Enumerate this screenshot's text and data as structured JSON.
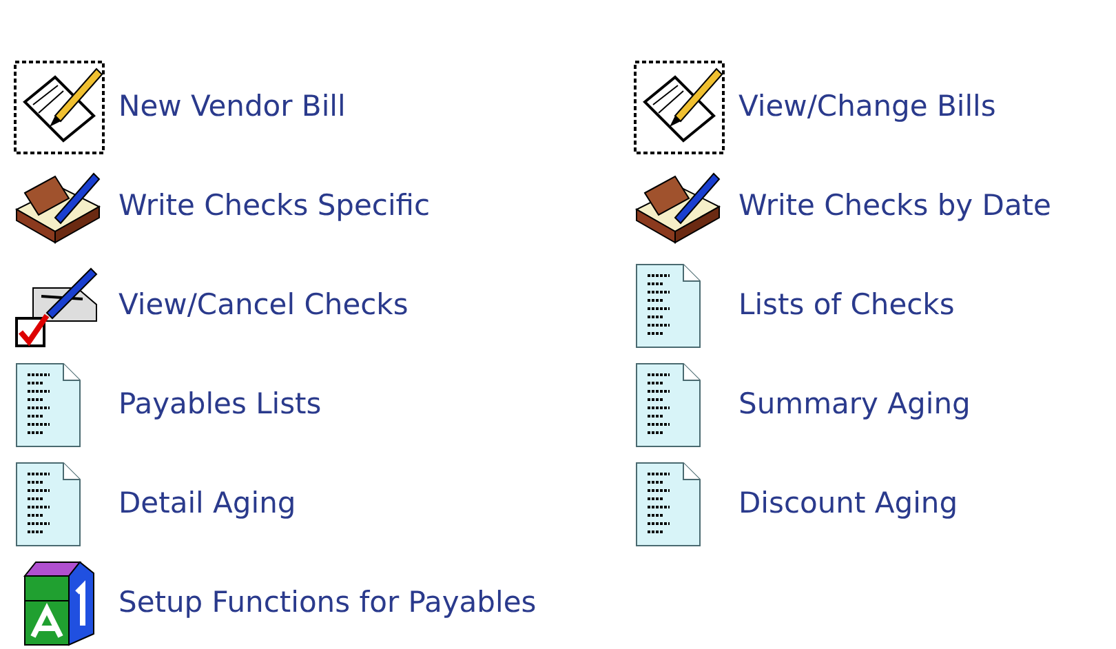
{
  "menu": [
    {
      "label": "New Vendor Bill",
      "kind": "bill"
    },
    {
      "label": "View/Change Bills",
      "kind": "bill"
    },
    {
      "label": "Write Checks Specific",
      "kind": "checkbook"
    },
    {
      "label": "Write Checks by Date",
      "kind": "checkbook"
    },
    {
      "label": "View/Cancel Checks",
      "kind": "cancel"
    },
    {
      "label": "Lists of Checks",
      "kind": "report"
    },
    {
      "label": "Payables Lists",
      "kind": "report"
    },
    {
      "label": "Summary Aging",
      "kind": "report"
    },
    {
      "label": "Detail Aging",
      "kind": "report"
    },
    {
      "label": "Discount Aging",
      "kind": "report"
    },
    {
      "label": "Setup Functions for Payables",
      "kind": "blocks"
    }
  ]
}
